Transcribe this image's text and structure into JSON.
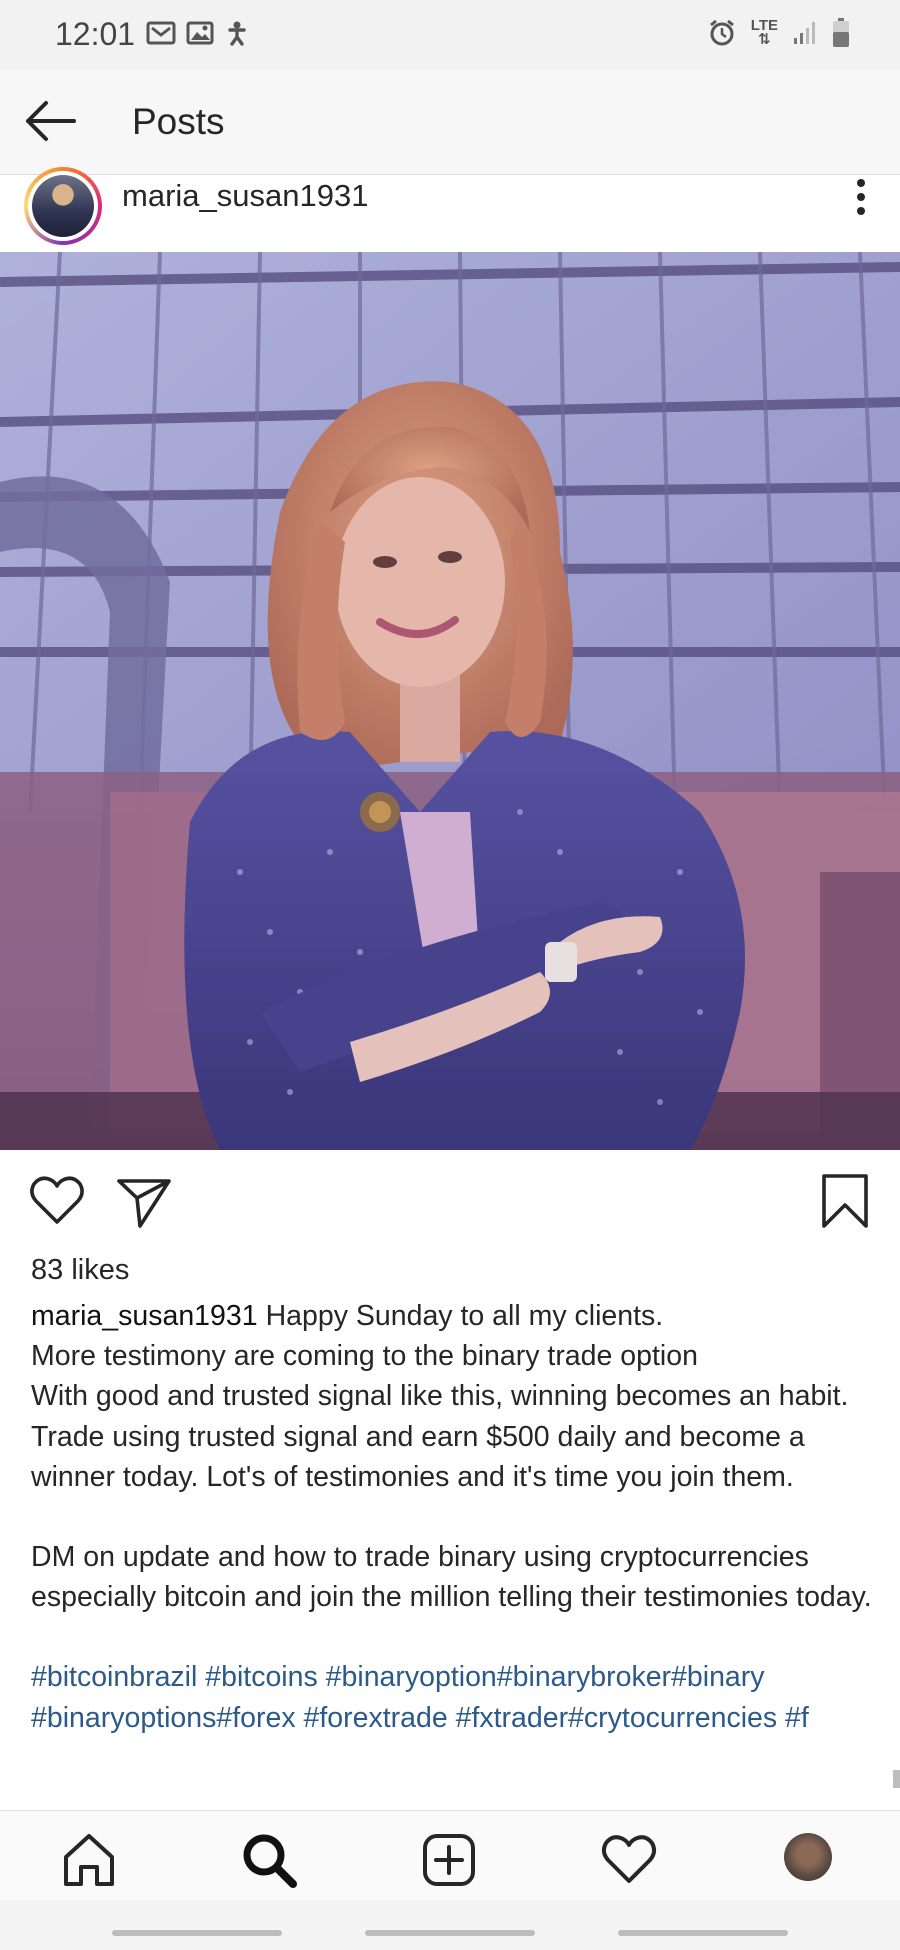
{
  "status_bar": {
    "time": "12:01",
    "network": "LTE",
    "left_icons": [
      "mail-icon",
      "gallery-icon",
      "accessibility-icon"
    ],
    "right_icons": [
      "alarm-icon",
      "lte-icon",
      "signal-icon",
      "battery-icon"
    ]
  },
  "header": {
    "title": "Posts"
  },
  "post": {
    "username": "maria_susan1931",
    "likes": "83 likes",
    "caption_user": "maria_susan1931",
    "caption_lines": [
      "Happy Sunday to all my clients.",
      "More testimony are coming to the binary trade option",
      "With good and trusted signal like this, winning becomes an habit. Trade using trusted signal and earn $500 daily and become a winner today. Lot's of testimonies and it's time you join them."
    ],
    "caption_paragraph_2": "DM on update and how to trade binary using cryptocurrencies especially bitcoin and join the million telling their testimonies today.",
    "hashtags": "#bitcoinbrazil #bitcoins #binaryoption#binarybroker#binary #binaryoptions#forex #forextrade #fxtrader#crytocurrencies #f"
  },
  "bottom_nav": {
    "items": [
      "home-icon",
      "search-icon",
      "add-icon",
      "heart-icon",
      "profile-avatar"
    ]
  },
  "colors": {
    "hashtag": "#2b5a8a",
    "text": "#262626"
  }
}
